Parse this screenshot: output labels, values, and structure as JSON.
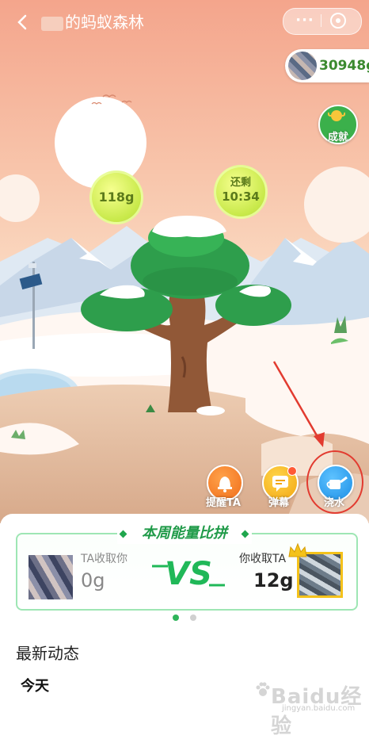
{
  "header": {
    "title": "的蚂蚁森林",
    "more_label": "···"
  },
  "energy": {
    "total": "30948g"
  },
  "achievement": {
    "label": "成就"
  },
  "bubbles": {
    "ready_amount": "118g",
    "countdown_label": "还剩",
    "countdown_time": "10:34"
  },
  "actions": {
    "remind_label": "提醒TA",
    "danmu_label": "弹幕",
    "water_label": "浇水"
  },
  "weekly": {
    "title": "本周能量比拼",
    "left_label": "TA收取你",
    "left_value": "0g",
    "vs": "VS",
    "right_label": "你收取TA",
    "right_value": "12g"
  },
  "feed": {
    "title": "最新动态",
    "today": "今天"
  },
  "watermark": {
    "main": "Baidu经验",
    "sub": "jingyan.baidu.com"
  },
  "colors": {
    "brand_green": "#1f9a48",
    "annotation_red": "#e23b30",
    "sky_top": "#f5a68c"
  }
}
